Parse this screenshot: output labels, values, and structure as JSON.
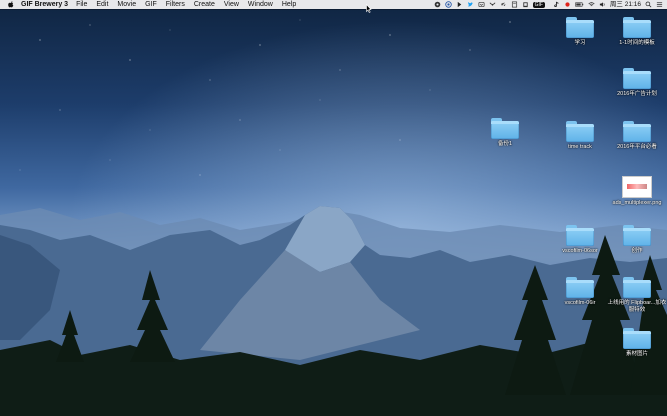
{
  "menubar": {
    "app_name": "GIF Brewery 3",
    "menus": [
      "File",
      "Edit",
      "Movie",
      "GIF",
      "Filters",
      "Create",
      "View",
      "Window",
      "Help"
    ],
    "gif_badge": "GIF",
    "datetime": "周三 21:16 ",
    "icons": [
      "apple-icon",
      "status-icon-1",
      "status-icon-2",
      "status-icon-3",
      "twitter-icon",
      "status-icon-4",
      "wifi-signal-icon",
      "link-icon",
      "status-icon-5",
      "clipboard-icon",
      "tiktok-icon",
      "record-icon",
      "battery-icon",
      "wifi-icon",
      "volume-icon"
    ]
  },
  "desktop": {
    "items": [
      {
        "label": "学习",
        "kind": "folder"
      },
      {
        "label": "1-1时间的模板",
        "kind": "folder"
      },
      {
        "label": "2016年广告计划",
        "kind": "folder"
      },
      {
        "label": "备份1",
        "kind": "folder"
      },
      {
        "label": "time track",
        "kind": "folder"
      },
      {
        "label": "2016年平台必看",
        "kind": "folder"
      },
      {
        "label": "ads_multiplexer.png",
        "kind": "image"
      },
      {
        "label": "vscofilm-06sor",
        "kind": "folder"
      },
      {
        "label": "创作",
        "kind": "folder"
      },
      {
        "label": "vscofilm-06ir",
        "kind": "folder"
      },
      {
        "label": "上线用的 Flipboar...加衣服特效",
        "kind": "folder"
      },
      {
        "label": "素材图片",
        "kind": "folder"
      }
    ]
  }
}
